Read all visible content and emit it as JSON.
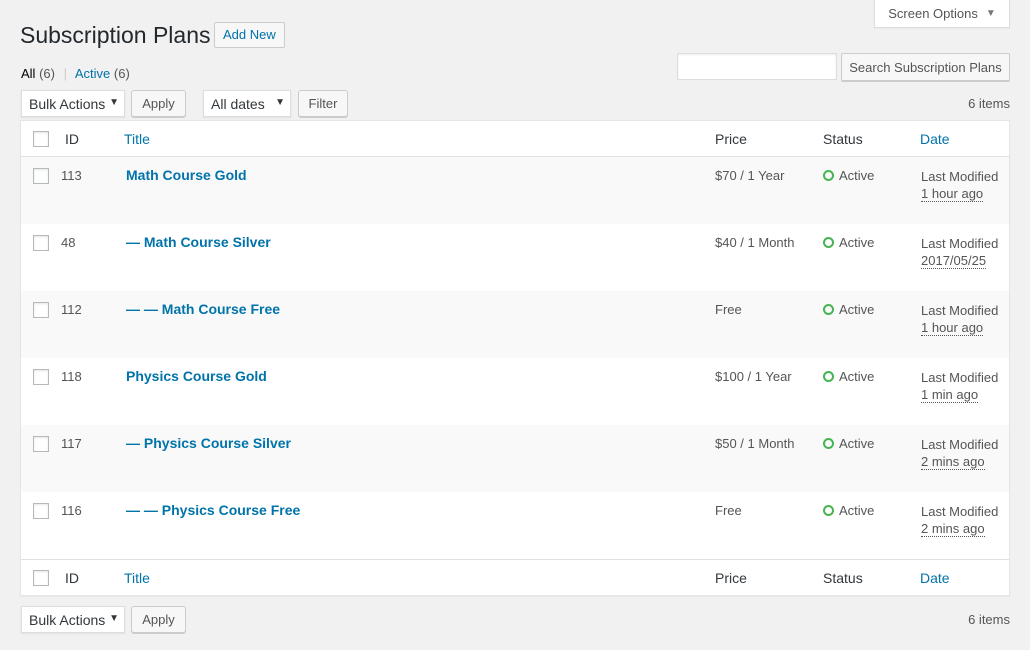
{
  "screen_options": {
    "label": "Screen Options"
  },
  "page": {
    "title": "Subscription Plans",
    "add_new": "Add New"
  },
  "filters": {
    "all_label": "All",
    "all_count": "(6)",
    "active_label": "Active",
    "active_count": "(6)",
    "separator": "|"
  },
  "search": {
    "button": "Search Subscription Plans",
    "value": ""
  },
  "top_nav": {
    "bulk_actions": "Bulk Actions",
    "apply": "Apply",
    "dates": "All dates",
    "filter": "Filter",
    "items": "6 items"
  },
  "bottom_nav": {
    "bulk_actions": "Bulk Actions",
    "apply": "Apply",
    "items": "6 items"
  },
  "columns": {
    "id": "ID",
    "title": "Title",
    "price": "Price",
    "status": "Status",
    "date": "Date"
  },
  "rows": [
    {
      "id": "113",
      "title": "Math Course Gold",
      "price": "$70 / 1 Year",
      "status": "Active",
      "date_label": "Last Modified",
      "date_value": "1 hour ago"
    },
    {
      "id": "48",
      "title": "— Math Course Silver",
      "price": "$40 / 1 Month",
      "status": "Active",
      "date_label": "Last Modified",
      "date_value": "2017/05/25"
    },
    {
      "id": "112",
      "title": "— — Math Course Free",
      "price": "Free",
      "status": "Active",
      "date_label": "Last Modified",
      "date_value": "1 hour ago"
    },
    {
      "id": "118",
      "title": "Physics Course Gold",
      "price": "$100 / 1 Year",
      "status": "Active",
      "date_label": "Last Modified",
      "date_value": "1 min ago"
    },
    {
      "id": "117",
      "title": "— Physics Course Silver",
      "price": "$50 / 1 Month",
      "status": "Active",
      "date_label": "Last Modified",
      "date_value": "2 mins ago"
    },
    {
      "id": "116",
      "title": "— — Physics Course Free",
      "price": "Free",
      "status": "Active",
      "date_label": "Last Modified",
      "date_value": "2 mins ago"
    }
  ],
  "colors": {
    "link": "#0073aa",
    "active_status": "#46b450",
    "background": "#f1f1f1"
  },
  "icons": {
    "dropdown": "caret-down-icon",
    "status": "status-circle-icon"
  }
}
